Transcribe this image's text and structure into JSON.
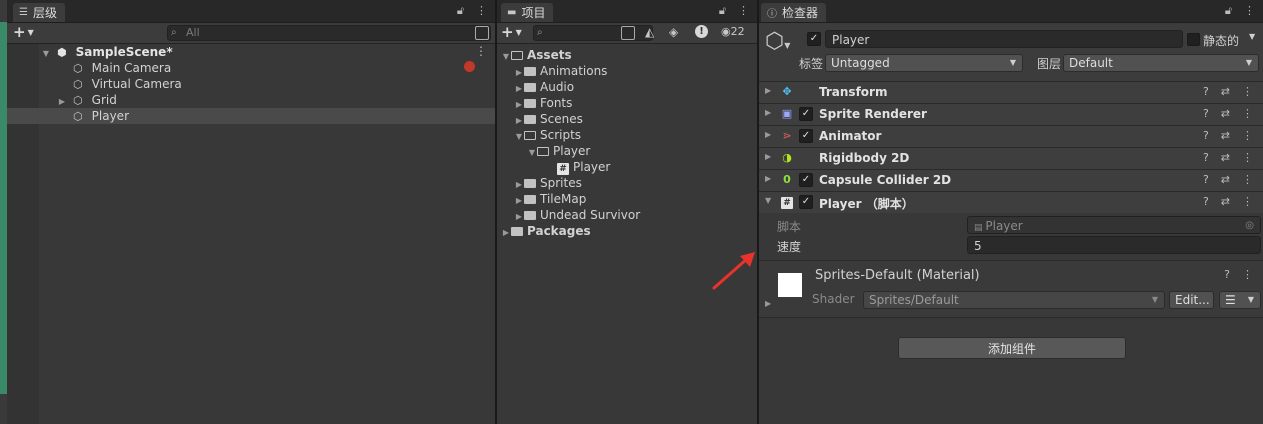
{
  "hierarchy": {
    "tab_label": "层级",
    "search_placeholder": "All",
    "scene_name": "SampleScene*",
    "items": [
      {
        "label": "Main Camera"
      },
      {
        "label": "Virtual Camera"
      },
      {
        "label": "Grid"
      },
      {
        "label": "Player"
      }
    ]
  },
  "project": {
    "tab_label": "项目",
    "hidden_count": "22",
    "tree": {
      "assets": "Assets",
      "animations": "Animations",
      "audio": "Audio",
      "fonts": "Fonts",
      "scenes": "Scenes",
      "scripts": "Scripts",
      "player_folder": "Player",
      "player_script": "Player",
      "sprites": "Sprites",
      "tilemap": "TileMap",
      "undead": "Undead Survivor",
      "packages": "Packages"
    }
  },
  "inspector": {
    "tab_label": "检查器",
    "object_name": "Player",
    "static_label": "静态的",
    "tag_label": "标签",
    "tag_value": "Untagged",
    "layer_label": "图层",
    "layer_value": "Default",
    "components": [
      {
        "name": "Transform",
        "icon": "transform-icon",
        "color": "#4fc3f7"
      },
      {
        "name": "Sprite Renderer",
        "icon": "sprite-renderer-icon",
        "color": "#9aa7ff"
      },
      {
        "name": "Animator",
        "icon": "animator-icon",
        "color": "#e06060"
      },
      {
        "name": "Rigidbody 2D",
        "icon": "rigidbody-icon",
        "color": "#b4e61e"
      },
      {
        "name": "Capsule Collider 2D",
        "icon": "capsule-collider-icon",
        "color": "#8ee33c"
      },
      {
        "name": "Player （脚本）",
        "icon": "script-icon",
        "color": "#e4e4e4"
      }
    ],
    "script_label": "脚本",
    "script_value": "Player",
    "speed_label": "速度",
    "speed_value": "5",
    "material_name": "Sprites-Default (Material)",
    "shader_label": "Shader",
    "shader_value": "Sprites/Default",
    "edit_label": "Edit...",
    "add_component_label": "添加组件"
  },
  "colors": {
    "annotation_arrow": "#e8322b",
    "left_strip": "#3a8a6a"
  }
}
